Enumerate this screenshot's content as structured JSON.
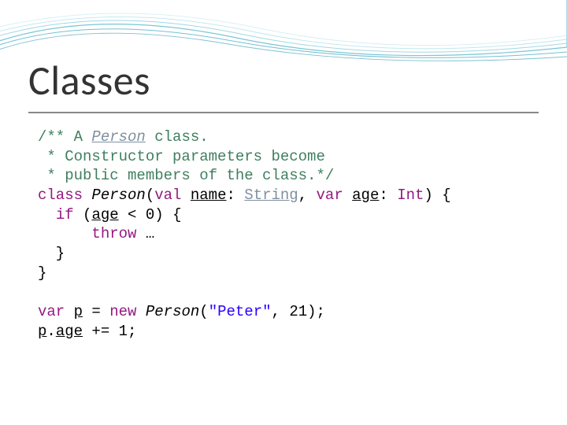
{
  "title": "Classes",
  "code": {
    "c1": "/** A ",
    "c1_person": "Person",
    "c1_rest": " class.",
    "c2": " * Constructor parameters become",
    "c3": " * public members of the class.*/",
    "l1_class": "class",
    "l1_person": "Person",
    "l1_open": "(",
    "l1_val": "val",
    "l1_sp1": " ",
    "l1_name": "name",
    "l1_colon1": ": ",
    "l1_string": "String",
    "l1_comma": ", ",
    "l1_var": "var",
    "l1_sp2": " ",
    "l1_age": "age",
    "l1_colon2": ": ",
    "l1_int": "Int",
    "l1_close": ") {",
    "l2_indent": "  ",
    "l2_if": "if",
    "l2_rest": " (",
    "l2_age": "age",
    "l2_cond": " < 0) {",
    "l3_indent": "      ",
    "l3_throw": "throw",
    "l3_rest": " …",
    "l4": "  }",
    "l5": "}",
    "l6_var": "var",
    "l6_sp": " ",
    "l6_p": "p",
    "l6_eq": " = ",
    "l6_new": "new",
    "l6_sp2": " ",
    "l6_person": "Person",
    "l6_open": "(",
    "l6_str": "\"Peter\"",
    "l6_rest": ", 21);",
    "l7_p": "p",
    "l7_dot": ".",
    "l7_age": "age",
    "l7_rest": " += 1;"
  }
}
